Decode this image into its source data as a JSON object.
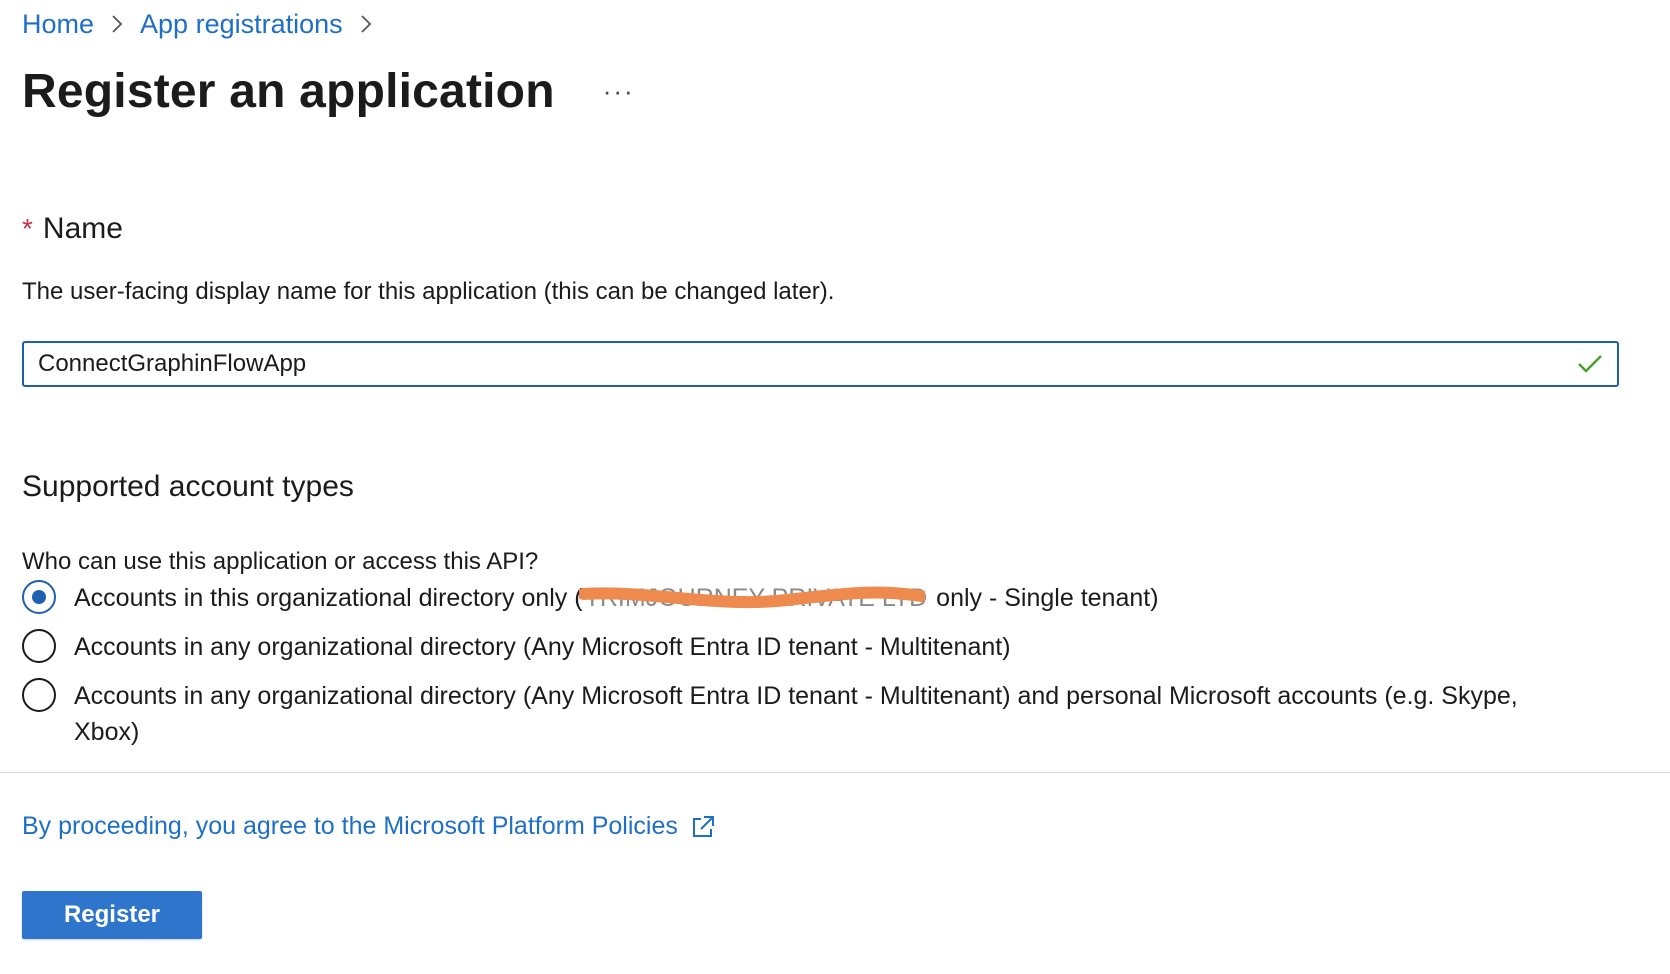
{
  "breadcrumb": {
    "items": [
      {
        "label": "Home"
      },
      {
        "label": "App registrations"
      }
    ]
  },
  "header": {
    "title": "Register an application",
    "more_label": "···"
  },
  "name_section": {
    "required_mark": "*",
    "label": "Name",
    "description": "The user-facing display name for this application (this can be changed later).",
    "field_value": "ConnectGraphinFlowApp",
    "valid": true
  },
  "account_types": {
    "heading": "Supported account types",
    "question": "Who can use this application or access this API?",
    "options": [
      {
        "prefix": "Accounts in this organizational directory only (",
        "redacted": "TRIMJOURNEY PRIVATE LTD",
        "suffix": " only - Single tenant)",
        "selected": true
      },
      {
        "label": "Accounts in any organizational directory (Any Microsoft Entra ID tenant - Multitenant)",
        "selected": false
      },
      {
        "label": "Accounts in any organizational directory (Any Microsoft Entra ID tenant - Multitenant) and personal Microsoft accounts (e.g. Skype, Xbox)",
        "selected": false
      }
    ]
  },
  "footer": {
    "policy_text": "By proceeding, you agree to the Microsoft Platform Policies",
    "register_label": "Register"
  },
  "colors": {
    "link": "#1f6fc5",
    "primary": "#2f75cc",
    "required": "#c4314b",
    "valid_check": "#4a9e2f",
    "redaction": "#ef8a4f"
  }
}
